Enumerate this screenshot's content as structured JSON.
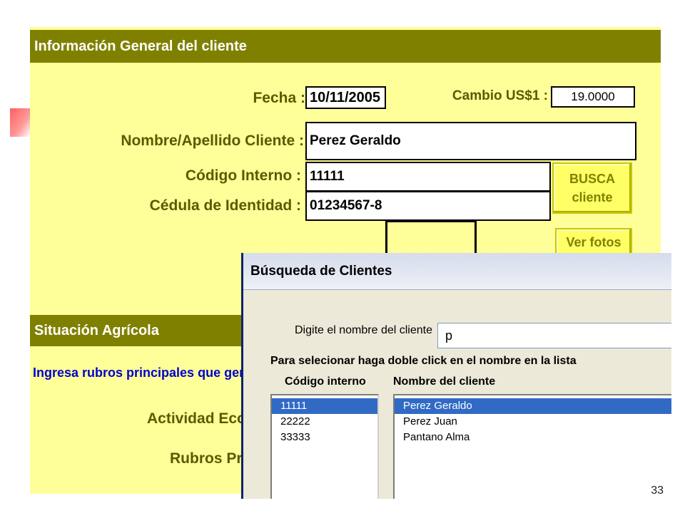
{
  "form": {
    "section1_title": "Información General del cliente",
    "fecha_label": "Fecha :",
    "fecha_value": "10/11/2005",
    "cambio_label": "Cambio US$1 :",
    "cambio_value": "19.0000",
    "nombre_label": "Nombre/Apellido Cliente :",
    "nombre_value": "Perez Geraldo",
    "codigo_label": "Código Interno :",
    "codigo_value": "11111",
    "cedula_label": "Cédula de Identidad :",
    "cedula_value": "01234567-8",
    "busca_button_line1": "BUSCA",
    "busca_button_line2": "cliente",
    "fotos_button": "Ver fotos",
    "section2_title": "Situación Agrícola",
    "rubros_instruction": "Ingresa rubros principales que gener",
    "actividad_label": "Actividad Econo",
    "rubros_label": "Rubros Prin"
  },
  "dialog": {
    "title": "Búsqueda de Clientes",
    "search_label": "Digite el nombre del cliente",
    "search_value": "p",
    "instruction": "Para selecionar haga doble click en el nombre en la lista",
    "col_codigo": "Código interno",
    "col_nombre": "Nombre del cliente",
    "codigos": [
      "11111",
      "22222",
      "33333"
    ],
    "nombres": [
      "Perez Geraldo",
      "Perez Juan",
      "Pantano Alma"
    ],
    "selected_index": 0
  },
  "slide_number": "33"
}
